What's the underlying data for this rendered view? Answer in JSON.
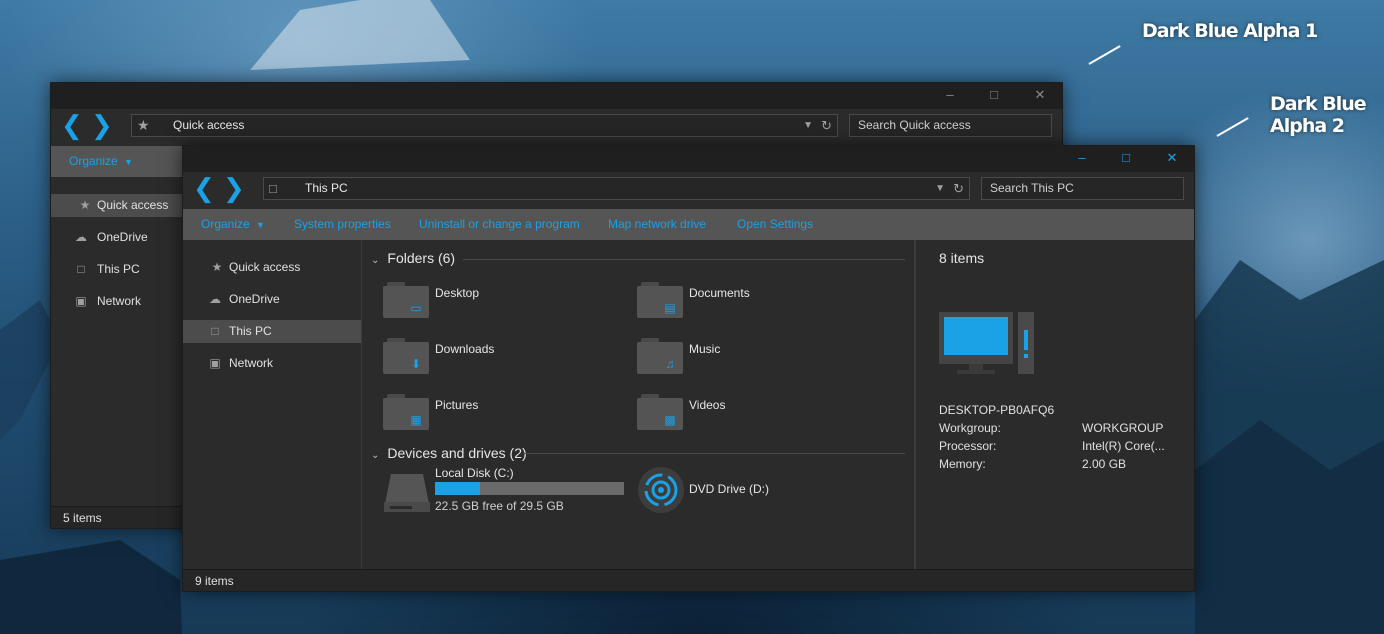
{
  "wallpaper_labels": {
    "first": "Dark Blue Alpha 1",
    "second": "Dark Blue Alpha 2"
  },
  "colors": {
    "accent": "#1aa1e6",
    "window_bg": "#2b2b2b",
    "cmdbar_bg": "#555555",
    "titlebar_bg": "#1f1f1f"
  },
  "window1": {
    "address": "Quick access",
    "search_placeholder": "Search Quick access",
    "organize": "Organize",
    "nav": [
      {
        "label": "Quick access",
        "icon": "star-icon"
      },
      {
        "label": "OneDrive",
        "icon": "cloud-icon"
      },
      {
        "label": "This PC",
        "icon": "monitor-icon"
      },
      {
        "label": "Network",
        "icon": "network-icon"
      }
    ],
    "status": "5 items"
  },
  "window2": {
    "address": "This PC",
    "search_placeholder": "Search This PC",
    "commands": [
      "Organize",
      "System properties",
      "Uninstall or change a program",
      "Map network drive",
      "Open Settings"
    ],
    "nav": [
      {
        "label": "Quick access",
        "icon": "star-icon"
      },
      {
        "label": "OneDrive",
        "icon": "cloud-icon"
      },
      {
        "label": "This PC",
        "icon": "monitor-icon"
      },
      {
        "label": "Network",
        "icon": "network-icon"
      }
    ],
    "folders_header": "Folders (6)",
    "folders": [
      {
        "name": "Desktop",
        "icon": "desktop-glyph"
      },
      {
        "name": "Documents",
        "icon": "document-glyph"
      },
      {
        "name": "Downloads",
        "icon": "download-arrow-glyph"
      },
      {
        "name": "Music",
        "icon": "music-note-glyph"
      },
      {
        "name": "Pictures",
        "icon": "picture-glyph"
      },
      {
        "name": "Videos",
        "icon": "film-glyph"
      }
    ],
    "drives_header": "Devices and drives (2)",
    "drives": {
      "local": {
        "name": "Local Disk (C:)",
        "free_text": "22.5 GB free of 29.5 GB",
        "used_fraction": 0.237
      },
      "dvd": {
        "name": "DVD Drive (D:)"
      }
    },
    "details": {
      "count": "8 items",
      "computer_name": "DESKTOP-PB0AFQ6",
      "rows": [
        {
          "key": "Workgroup:",
          "value": "WORKGROUP"
        },
        {
          "key": "Processor:",
          "value": "Intel(R) Core(..."
        },
        {
          "key": "Memory:",
          "value": "2.00 GB"
        }
      ]
    },
    "status": "9 items"
  }
}
